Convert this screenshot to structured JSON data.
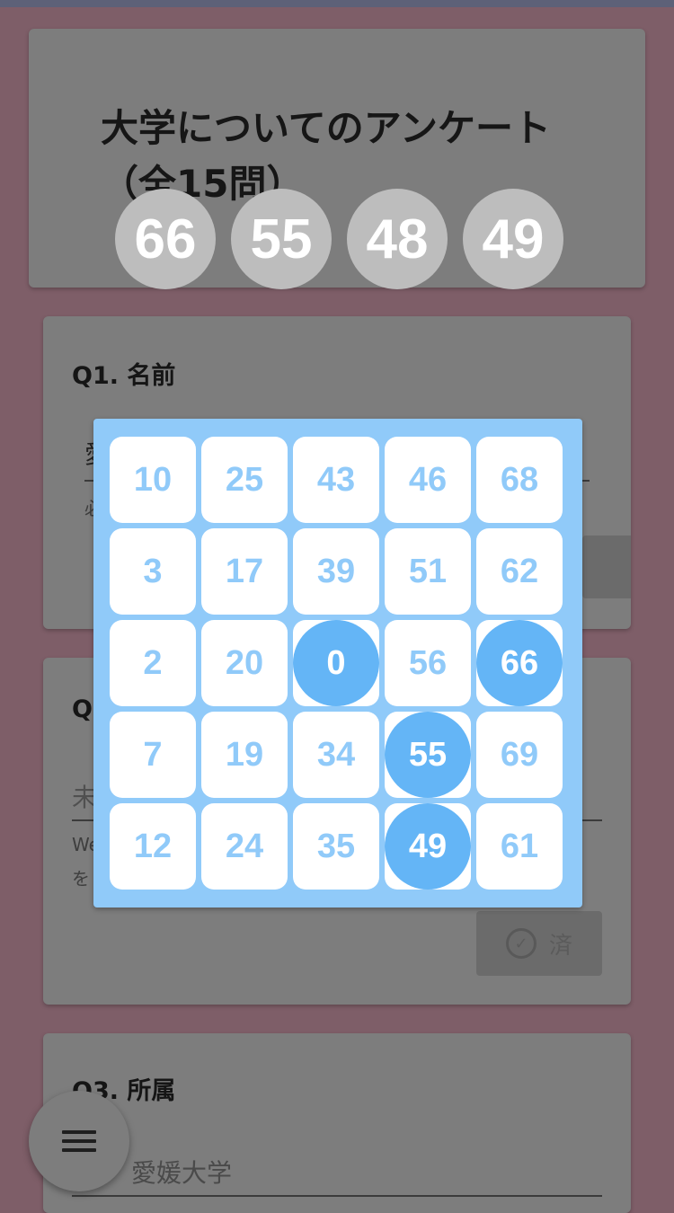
{
  "survey": {
    "title": "大学についてのアンケート（全15問）",
    "q1": {
      "title": "Q1. 名前",
      "value_fragment": "愛",
      "helper_fragment": "必"
    },
    "q2": {
      "title": "Q",
      "placeholder_fragment": "未",
      "helper_line1_fragment": "We",
      "helper_line2_fragment": "を",
      "done_label": "済"
    },
    "q3": {
      "title": "Q3. 所属",
      "value": "愛媛大学"
    }
  },
  "called_numbers": [
    "66",
    "55",
    "48",
    "49"
  ],
  "bingo": {
    "cells": [
      [
        {
          "n": "10",
          "marked": false
        },
        {
          "n": "25",
          "marked": false
        },
        {
          "n": "43",
          "marked": false
        },
        {
          "n": "46",
          "marked": false
        },
        {
          "n": "68",
          "marked": false
        }
      ],
      [
        {
          "n": "3",
          "marked": false
        },
        {
          "n": "17",
          "marked": false
        },
        {
          "n": "39",
          "marked": false
        },
        {
          "n": "51",
          "marked": false
        },
        {
          "n": "62",
          "marked": false
        }
      ],
      [
        {
          "n": "2",
          "marked": false
        },
        {
          "n": "20",
          "marked": false
        },
        {
          "n": "0",
          "marked": true
        },
        {
          "n": "56",
          "marked": false
        },
        {
          "n": "66",
          "marked": true
        }
      ],
      [
        {
          "n": "7",
          "marked": false
        },
        {
          "n": "19",
          "marked": false
        },
        {
          "n": "34",
          "marked": false
        },
        {
          "n": "55",
          "marked": true
        },
        {
          "n": "69",
          "marked": false
        }
      ],
      [
        {
          "n": "12",
          "marked": false
        },
        {
          "n": "24",
          "marked": false
        },
        {
          "n": "35",
          "marked": false
        },
        {
          "n": "49",
          "marked": true
        },
        {
          "n": "61",
          "marked": false
        }
      ]
    ]
  },
  "fab": {
    "icon": "menu-icon"
  },
  "colors": {
    "board": "#90caf9",
    "mark": "#64b5f6",
    "called_ball": "#bdbdbd"
  }
}
